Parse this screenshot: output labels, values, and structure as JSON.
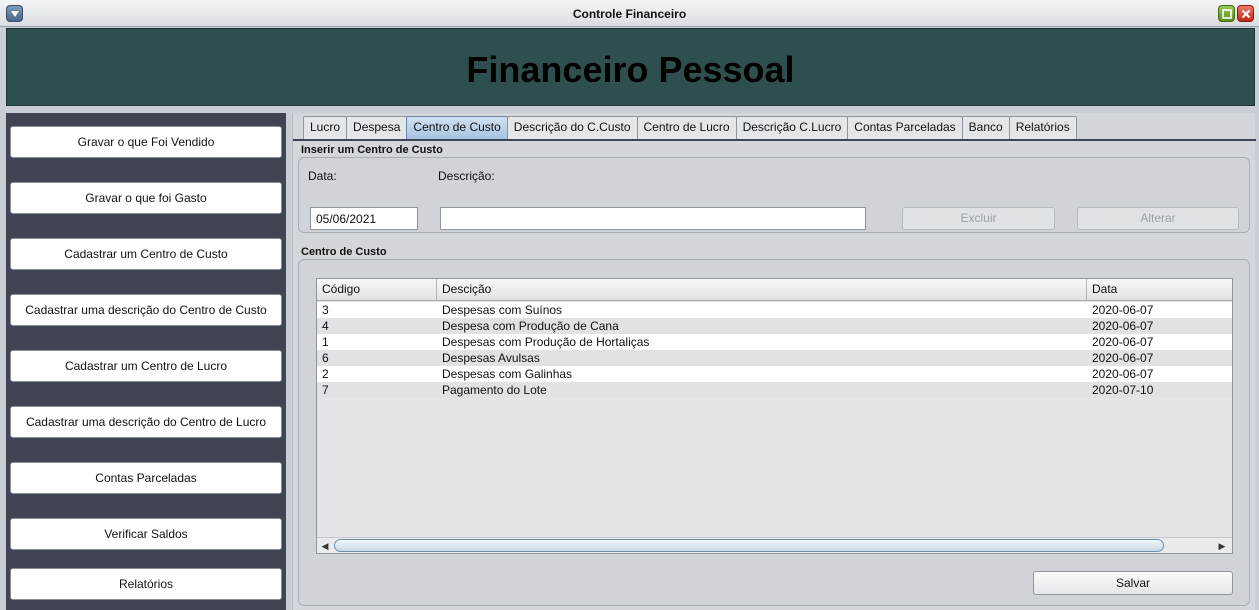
{
  "window": {
    "title": "Controle Financeiro"
  },
  "banner": {
    "heading": "Financeiro Pessoal"
  },
  "sidebar": {
    "buttons": [
      "Gravar o que Foi Vendido",
      "Gravar o que foi Gasto",
      "Cadastrar um Centro de Custo",
      "Cadastrar uma descrição do Centro de Custo",
      "Cadastrar um Centro de Lucro",
      "Cadastrar uma descrição do Centro de Lucro",
      "Contas Parceladas",
      "Verificar Saldos",
      "Relatórios"
    ]
  },
  "tabs": [
    {
      "label": "Lucro",
      "active": false
    },
    {
      "label": "Despesa",
      "active": false
    },
    {
      "label": "Centro de Custo",
      "active": true
    },
    {
      "label": "Descrição do C.Custo",
      "active": false
    },
    {
      "label": "Centro de Lucro",
      "active": false
    },
    {
      "label": "Descrição C.Lucro",
      "active": false
    },
    {
      "label": "Contas Parceladas",
      "active": false
    },
    {
      "label": "Banco",
      "active": false
    },
    {
      "label": "Relatórios",
      "active": false
    }
  ],
  "form": {
    "section_title": "Inserir um Centro de Custo",
    "date_label": "Data:",
    "date_value": "05/06/2021",
    "description_label": "Descrição:",
    "description_value": "",
    "delete_label": "Excluir",
    "update_label": "Alterar"
  },
  "list": {
    "section_title": "Centro de Custo",
    "columns": [
      "Código",
      "Descição",
      "Data"
    ],
    "rows": [
      [
        "3",
        "Despesas com Suínos",
        "2020-06-07"
      ],
      [
        "4",
        "Despesa com Produção de Cana",
        "2020-06-07"
      ],
      [
        "1",
        "Despesas com Produção de Hortaliças",
        "2020-06-07"
      ],
      [
        "6",
        "Despesas Avulsas",
        "2020-06-07"
      ],
      [
        "2",
        "Despesas com Galinhas",
        "2020-06-07"
      ],
      [
        "7",
        "Pagamento do Lote",
        "2020-07-10"
      ]
    ]
  },
  "save_label": "Salvar"
}
